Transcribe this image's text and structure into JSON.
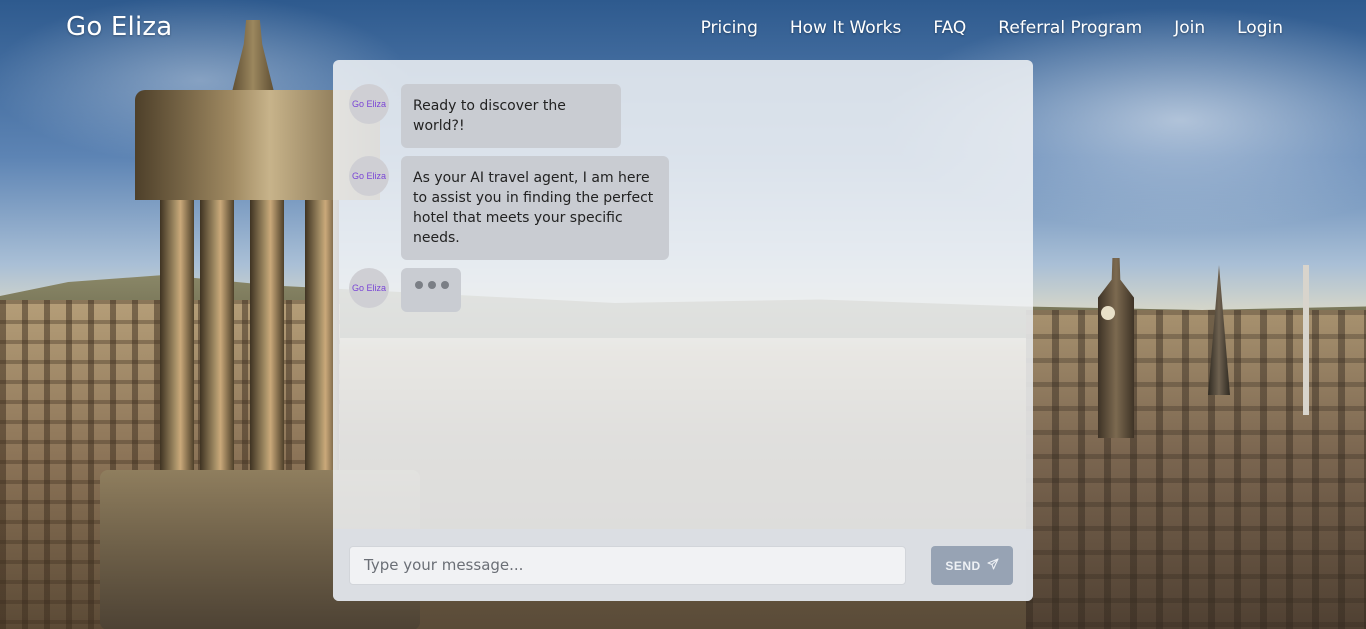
{
  "header": {
    "brand": "Go Eliza",
    "nav": [
      "Pricing",
      "How It Works",
      "FAQ",
      "Referral Program",
      "Join",
      "Login"
    ]
  },
  "chat": {
    "avatar_label": "Go Eliza",
    "messages": [
      {
        "sender": "Go Eliza",
        "text": "Ready to discover the world?!"
      },
      {
        "sender": "Go Eliza",
        "text": "As your AI travel agent, I am here to assist you in finding the perfect hotel that meets your specific needs."
      },
      {
        "sender": "Go Eliza",
        "typing": true
      }
    ],
    "input": {
      "placeholder": "Type your message..."
    },
    "send_label": "SEND",
    "send_icon": "paper-plane-icon"
  }
}
